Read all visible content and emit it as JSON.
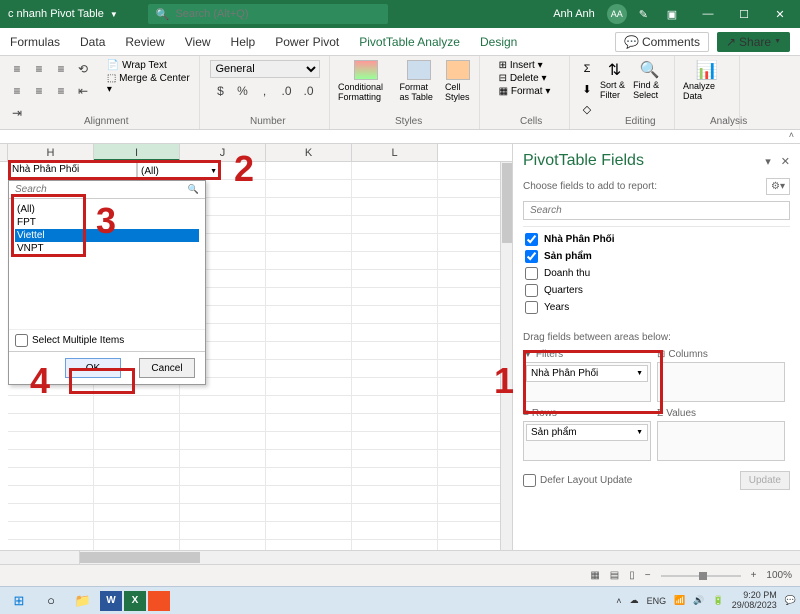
{
  "titlebar": {
    "doc_title": "c nhanh Pivot Table",
    "search_placeholder": "Search (Alt+Q)",
    "user_name": "Anh Anh",
    "user_initials": "AA"
  },
  "menu": {
    "items": [
      "Formulas",
      "Data",
      "Review",
      "View",
      "Help",
      "Power Pivot",
      "PivotTable Analyze",
      "Design"
    ],
    "active_indexes": [
      6,
      7
    ],
    "comments": "Comments",
    "share": "Share"
  },
  "ribbon": {
    "alignment": {
      "label": "Alignment",
      "wrap": "Wrap Text",
      "merge": "Merge & Center"
    },
    "number": {
      "label": "Number",
      "format": "General"
    },
    "styles": {
      "label": "Styles",
      "cond": "Conditional Formatting",
      "table": "Format as Table",
      "cell": "Cell Styles"
    },
    "cells": {
      "label": "Cells",
      "insert": "Insert",
      "delete": "Delete",
      "format": "Format"
    },
    "editing": {
      "label": "Editing",
      "sort": "Sort & Filter",
      "find": "Find & Select"
    },
    "analysis": {
      "label": "Analysis",
      "analyze": "Analyze Data"
    }
  },
  "columns": [
    "H",
    "I",
    "J",
    "K",
    "L"
  ],
  "active_col": "I",
  "filter": {
    "label": "Nhà Phân Phối",
    "value": "(All)",
    "search_placeholder": "Search",
    "items": [
      "(All)",
      "FPT",
      "Viettel",
      "VNPT"
    ],
    "selected_index": 2,
    "multi_label": "Select Multiple Items",
    "ok": "OK",
    "cancel": "Cancel"
  },
  "fields": {
    "title": "PivotTable Fields",
    "subtitle": "Choose fields to add to report:",
    "search_placeholder": "Search",
    "list": [
      {
        "name": "Nhà Phân Phối",
        "checked": true,
        "bold": true
      },
      {
        "name": "Sản phẩm",
        "checked": true,
        "bold": true
      },
      {
        "name": "Doanh thu",
        "checked": false,
        "bold": false
      },
      {
        "name": "Quarters",
        "checked": false,
        "bold": false
      },
      {
        "name": "Years",
        "checked": false,
        "bold": false
      }
    ],
    "drag_label": "Drag fields between areas below:",
    "areas": {
      "filters": {
        "label": "Filters",
        "item": "Nhà Phân Phối"
      },
      "columns": {
        "label": "Columns"
      },
      "rows": {
        "label": "Rows",
        "item": "Sản phẩm"
      },
      "values": {
        "label": "Values"
      }
    },
    "defer": "Defer Layout Update",
    "update": "Update"
  },
  "annotations": {
    "n1": "1",
    "n2": "2",
    "n3": "3",
    "n4": "4"
  },
  "status": {
    "zoom": "100%"
  },
  "taskbar": {
    "time": "9:20 PM",
    "date": "29/08/2023"
  }
}
